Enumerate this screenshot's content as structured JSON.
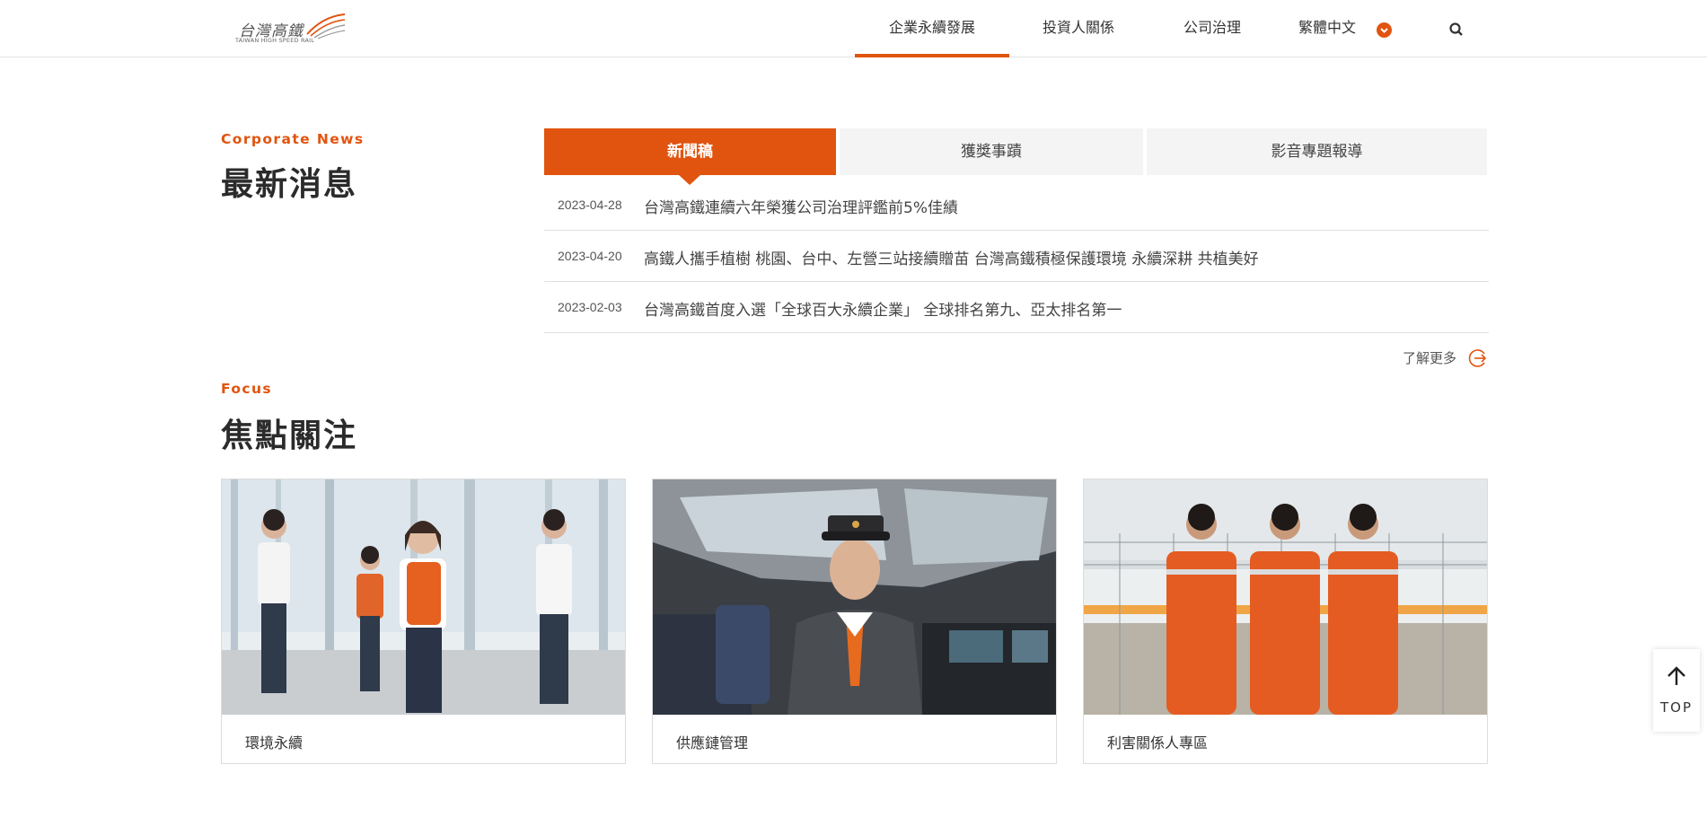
{
  "header": {
    "logo_cn": "台灣高鐵",
    "logo_en": "TAIWAN HIGH SPEED RAIL",
    "nav": [
      {
        "label": "企業永續發展"
      },
      {
        "label": "投資人關係"
      },
      {
        "label": "公司治理"
      },
      {
        "label": "繁體中文"
      }
    ],
    "search_icon": "search-icon",
    "accent_color": "#e1540f"
  },
  "news": {
    "eyebrow": "Corporate News",
    "title": "最新消息",
    "tabs": [
      {
        "label": "新聞稿"
      },
      {
        "label": "獲獎事蹟"
      },
      {
        "label": "影音專題報導"
      }
    ],
    "items": [
      {
        "date": "2023-04-28",
        "text": "台灣高鐵連續六年榮獲公司治理評鑑前5%佳績"
      },
      {
        "date": "2023-04-20",
        "text": "高鐵人攜手植樹 桃園、台中、左營三站接續贈苗 台灣高鐵積極保護環境 永續深耕 共植美好"
      },
      {
        "date": "2023-02-03",
        "text": "台灣高鐵首度入選「全球百大永續企業」 全球排名第九、亞太排名第一"
      }
    ],
    "more_label": "了解更多"
  },
  "focus": {
    "eyebrow": "Focus",
    "title": "焦點關注",
    "cards": [
      {
        "label": "環境永續"
      },
      {
        "label": "供應鏈管理"
      },
      {
        "label": "利害關係人專區"
      }
    ]
  },
  "top_button": {
    "label": "TOP"
  }
}
